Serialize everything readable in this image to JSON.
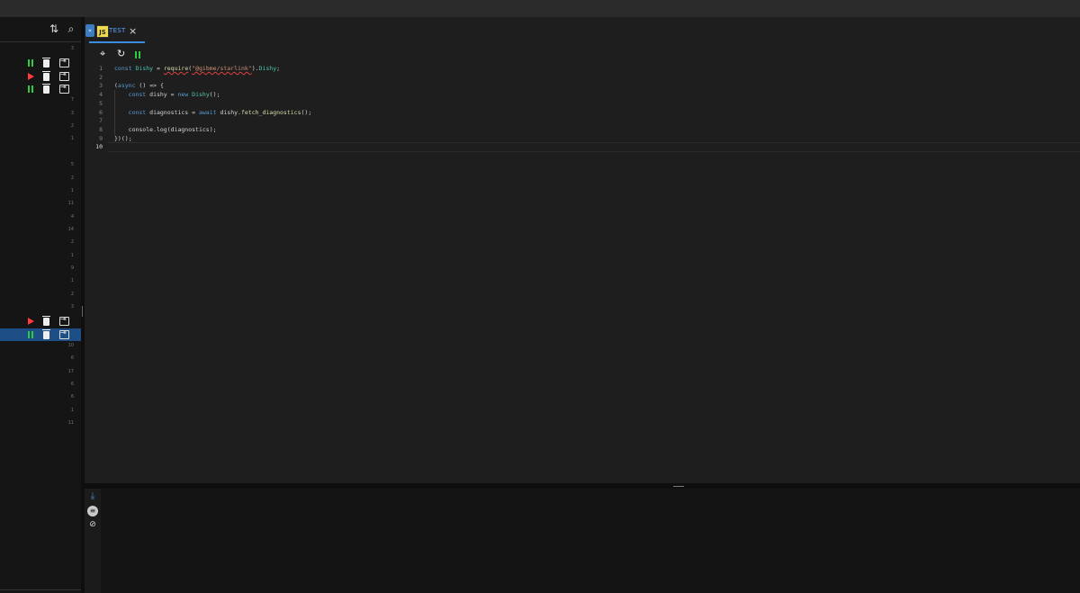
{
  "sidebar": {
    "rows": [
      {
        "num": "3",
        "controls": null,
        "selected": false
      },
      {
        "num": "",
        "controls": "pause",
        "selected": false
      },
      {
        "num": "",
        "controls": "play",
        "selected": false
      },
      {
        "num": "",
        "controls": "pause",
        "selected": false
      },
      {
        "num": "7",
        "controls": null,
        "selected": false
      },
      {
        "num": "3",
        "controls": null,
        "selected": false
      },
      {
        "num": "2",
        "controls": null,
        "selected": false
      },
      {
        "num": "1",
        "controls": null,
        "selected": false
      },
      {
        "num": "",
        "controls": null,
        "selected": false
      },
      {
        "num": "5",
        "controls": null,
        "selected": false
      },
      {
        "num": "2",
        "controls": null,
        "selected": false
      },
      {
        "num": "1",
        "controls": null,
        "selected": false
      },
      {
        "num": "11",
        "controls": null,
        "selected": false
      },
      {
        "num": "4",
        "controls": null,
        "selected": false
      },
      {
        "num": "14",
        "controls": null,
        "selected": false
      },
      {
        "num": "2",
        "controls": null,
        "selected": false
      },
      {
        "num": "1",
        "controls": null,
        "selected": false
      },
      {
        "num": "9",
        "controls": null,
        "selected": false
      },
      {
        "num": "1",
        "controls": null,
        "selected": false
      },
      {
        "num": "2",
        "controls": null,
        "selected": false
      },
      {
        "num": "3",
        "controls": null,
        "selected": false
      },
      {
        "num": "",
        "controls": "play",
        "selected": false
      },
      {
        "num": "",
        "controls": "pause",
        "selected": true
      },
      {
        "num": "10",
        "controls": null,
        "selected": false
      },
      {
        "num": "6",
        "controls": null,
        "selected": false
      },
      {
        "num": "17",
        "controls": null,
        "selected": false
      },
      {
        "num": "6",
        "controls": null,
        "selected": false
      },
      {
        "num": "6",
        "controls": null,
        "selected": false
      },
      {
        "num": "1",
        "controls": null,
        "selected": false
      },
      {
        "num": "11",
        "controls": null,
        "selected": false
      }
    ],
    "icons": {
      "sort": "sort-arrows-icon",
      "search": "search-icon"
    }
  },
  "tab": {
    "badge": "JS",
    "label": "TEST",
    "close": "×",
    "back": "«"
  },
  "toolbar": {
    "icons": [
      "target-icon",
      "refresh-icon",
      "pause-icon"
    ]
  },
  "editor": {
    "line_numbers": [
      "1",
      "2",
      "3",
      "4",
      "5",
      "6",
      "7",
      "8",
      "9",
      "10"
    ],
    "active_line": "10",
    "lines": [
      "const Dishy = require(\"@gibme/starlink\").Dishy;",
      "",
      "(async () => {",
      "    const dishy = new Dishy();",
      "",
      "    const diagnostics = await dishy.fetch_diagnostics();",
      "",
      "    console.log(diagnostics);",
      "})();",
      ""
    ]
  },
  "bottom_panel": {
    "icons": [
      "scroll-down-icon",
      "list-icon",
      "eye-off-icon"
    ]
  }
}
